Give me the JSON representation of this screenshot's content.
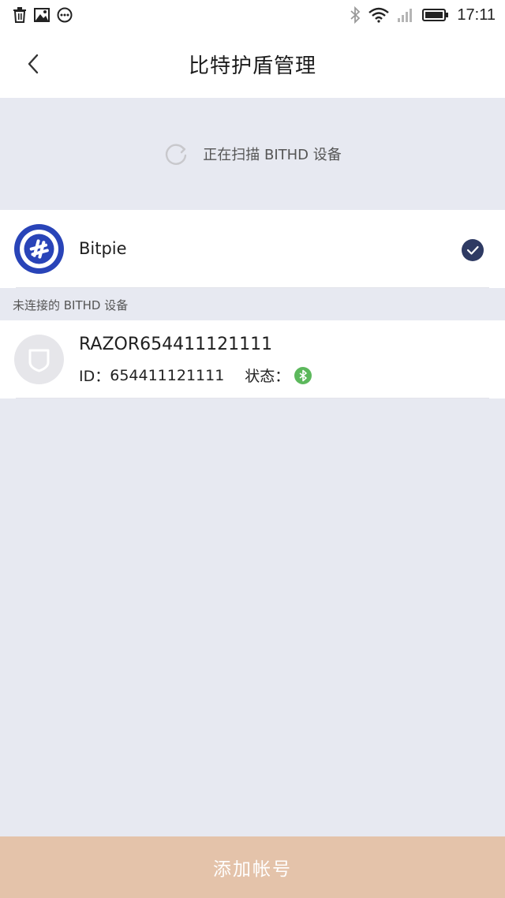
{
  "status_bar": {
    "time": "17:11",
    "left_icons": [
      "trash-icon",
      "image-icon",
      "more-dots-icon"
    ],
    "right_icons": [
      "bluetooth-icon",
      "wifi-icon",
      "signal-icon",
      "battery-icon"
    ]
  },
  "nav": {
    "title": "比特护盾管理",
    "back_icon": "chevron-left-icon"
  },
  "scan": {
    "icon": "loading-spinner-icon",
    "text": "正在扫描 BITHD 设备"
  },
  "connected_device": {
    "name": "Bitpie",
    "icon": "bitpie-logo-icon",
    "selected_icon": "check-circle-icon"
  },
  "unconnected_section": {
    "label": "未连接的 BITHD 设备",
    "devices": [
      {
        "name": "RAZOR654411121111",
        "id_label": "ID：",
        "id_value": "654411121111",
        "status_label": "状态：",
        "status_icon": "bluetooth-status-icon"
      }
    ]
  },
  "bottom_action": {
    "label": "添加帐号"
  },
  "colors": {
    "page_background": "#e7e9f1",
    "accent_button": "#e4c3aa",
    "bitpie_blue": "#2944b8",
    "check_badge": "#2e3a63",
    "bluetooth_green": "#5cb85c"
  }
}
